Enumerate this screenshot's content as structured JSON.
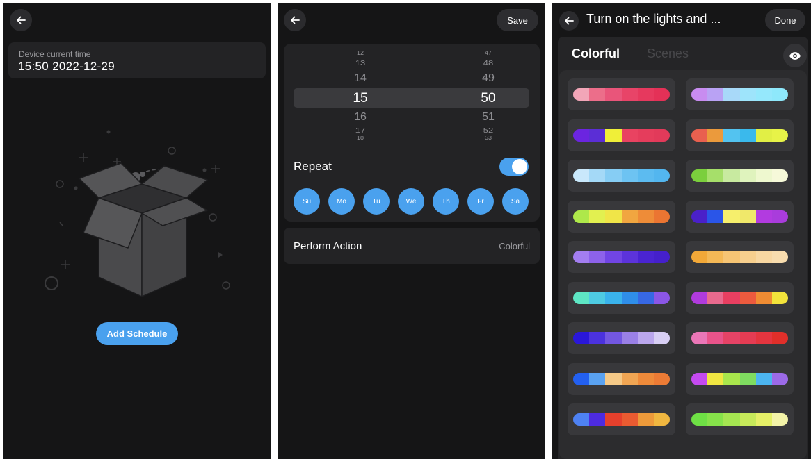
{
  "screen1": {
    "time_label": "Device current time",
    "time_value": "15:50 2022-12-29",
    "add_button": "Add Schedule",
    "accent": "#4aa1ee"
  },
  "screen2": {
    "save_label": "Save",
    "hours": [
      "12",
      "13",
      "14",
      "15",
      "16",
      "17",
      "18"
    ],
    "minutes": [
      "47",
      "48",
      "49",
      "50",
      "51",
      "52",
      "53"
    ],
    "selected_hour": "15",
    "selected_minute": "50",
    "repeat_label": "Repeat",
    "repeat_on": true,
    "days": [
      "Su",
      "Mo",
      "Tu",
      "We",
      "Th",
      "Fr",
      "Sa"
    ],
    "action_label": "Perform Action",
    "action_value": "Colorful"
  },
  "screen3": {
    "title": "Turn on the lights and ...",
    "done_label": "Done",
    "tabs": [
      {
        "label": "Colorful",
        "active": true
      },
      {
        "label": "Scenes",
        "active": false
      }
    ],
    "palettes": [
      [
        "#f2a6b8",
        "#ec6e8a",
        "#e9557a",
        "#e84468",
        "#e6395e",
        "#e43157"
      ],
      [
        "#c88cf0",
        "#b9a2f4",
        "#a8d9f9",
        "#9ee4fb",
        "#95e8fc",
        "#8ee8fb"
      ],
      [
        "#6b25e0",
        "#5b2ed6",
        "#f0ef38",
        "#e94361",
        "#e53d5c",
        "#e23a5a"
      ],
      [
        "#e9604f",
        "#eb9a3c",
        "#53c3f0",
        "#3ab9ec",
        "#e1ef45",
        "#e7f348"
      ],
      [
        "#c9e8fb",
        "#a4d9f7",
        "#86cdf4",
        "#6dc3f2",
        "#5cbbf0",
        "#53b6ef"
      ],
      [
        "#7bcf3d",
        "#a6df6a",
        "#c8eaa0",
        "#dff3bd",
        "#eef8cf",
        "#f6f9d9"
      ],
      [
        "#aee84a",
        "#e2f050",
        "#f0e548",
        "#f1a640",
        "#ee8c38",
        "#eb7532"
      ],
      [
        "#4a20c9",
        "#2a55e8",
        "#f6ef6c",
        "#f0e86a",
        "#b23be0",
        "#a93cdc"
      ],
      [
        "#a37ef0",
        "#8d62ea",
        "#7145e4",
        "#5c33db",
        "#4a24d2",
        "#4520cc"
      ],
      [
        "#f2a838",
        "#f4b856",
        "#f6c474",
        "#f7cf8e",
        "#f8d7a2",
        "#f8dcae"
      ],
      [
        "#5ee6c4",
        "#4ecbe2",
        "#3ab3ec",
        "#2f8ee9",
        "#3768e4",
        "#8b56e6"
      ],
      [
        "#b03bdd",
        "#e86a8e",
        "#e83f61",
        "#ec5a3e",
        "#ef8c33",
        "#f2e33b"
      ],
      [
        "#2a17d9",
        "#4b32de",
        "#7357e1",
        "#9a80e6",
        "#bba7ed",
        "#d8cff4"
      ],
      [
        "#ea76b7",
        "#e9538a",
        "#e64366",
        "#e53c53",
        "#e4353f",
        "#e02f2a"
      ],
      [
        "#2360f0",
        "#5aa2f1",
        "#f5c987",
        "#f0a553",
        "#ee8a3a",
        "#ec7b35"
      ],
      [
        "#c54af0",
        "#f0e642",
        "#a9e64c",
        "#7fdc60",
        "#4cb5f0",
        "#9c6ae8"
      ],
      [
        "#4e82f3",
        "#4d2be0",
        "#e6402c",
        "#ea5b31",
        "#ed9a3a",
        "#f0b740"
      ],
      [
        "#6ee045",
        "#86e24a",
        "#a5e551",
        "#c7ea5a",
        "#e5f067",
        "#f3f3a8"
      ]
    ]
  }
}
